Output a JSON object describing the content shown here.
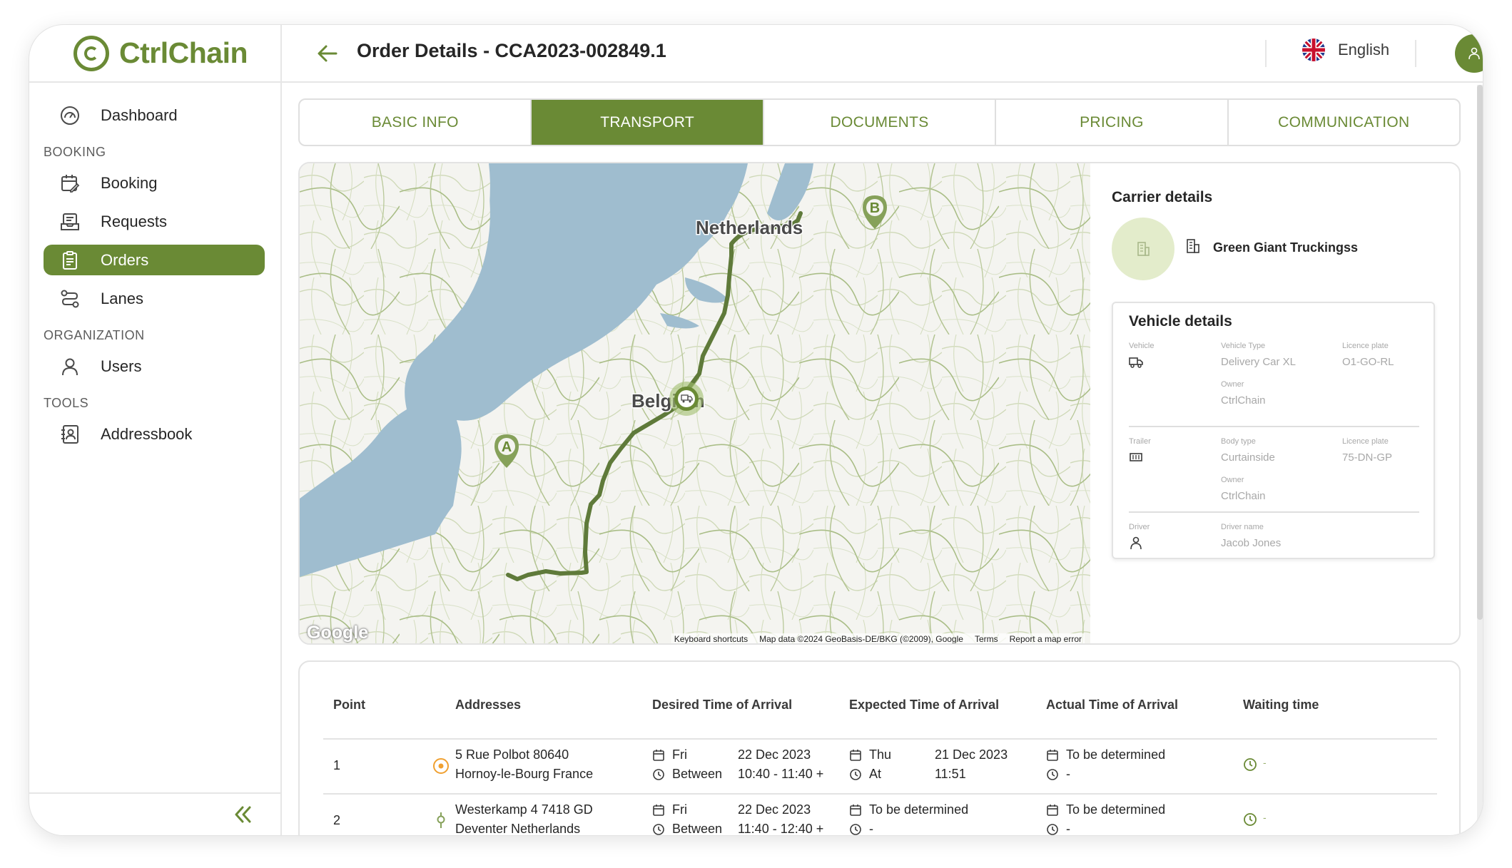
{
  "app": {
    "name": "CtrlChain"
  },
  "sidebar": {
    "items": [
      {
        "label": "Dashboard"
      },
      {
        "section": "BOOKING"
      },
      {
        "label": "Booking"
      },
      {
        "label": "Requests"
      },
      {
        "label": "Orders",
        "active": true
      },
      {
        "label": "Lanes"
      },
      {
        "section": "ORGANIZATION"
      },
      {
        "label": "Users"
      },
      {
        "section": "TOOLS"
      },
      {
        "label": "Addressbook"
      }
    ]
  },
  "header": {
    "title": "Order Details - CCA2023-002849.1",
    "language": "English"
  },
  "tabs": [
    {
      "label": "BASIC INFO"
    },
    {
      "label": "TRANSPORT",
      "active": true
    },
    {
      "label": "DOCUMENTS"
    },
    {
      "label": "PRICING"
    },
    {
      "label": "COMMUNICATION"
    }
  ],
  "map": {
    "labels": {
      "netherlands": "Netherlands",
      "belgium": "Belgium",
      "marker_a": "A",
      "marker_b": "B"
    },
    "footer": {
      "shortcuts": "Keyboard shortcuts",
      "mapdata": "Map data ©2024 GeoBasis-DE/BKG (©2009), Google",
      "terms": "Terms",
      "report": "Report a map error"
    },
    "google": "Google"
  },
  "carrier": {
    "title": "Carrier details",
    "name": "Green Giant Truckingss"
  },
  "vehicle_details": {
    "title": "Vehicle details",
    "vehicle": {
      "label": "Vehicle",
      "type_label": "Vehicle Type",
      "type": "Delivery Car XL",
      "plate_label": "Licence plate",
      "plate": "O1-GO-RL",
      "owner_label": "Owner",
      "owner": "CtrlChain"
    },
    "trailer": {
      "label": "Trailer",
      "type_label": "Body type",
      "type": "Curtainside",
      "plate_label": "Licence plate",
      "plate": "75-DN-GP",
      "owner_label": "Owner",
      "owner": "CtrlChain"
    },
    "driver": {
      "label": "Driver",
      "name_label": "Driver name",
      "name": "Jacob Jones"
    }
  },
  "points": {
    "headers": [
      "Point",
      "Addresses",
      "Desired Time of Arrival",
      "Expected Time of Arrival",
      "Actual Time of Arrival",
      "Waiting time"
    ],
    "rows": [
      {
        "point": "1",
        "address1": "5 Rue Polbot 80640",
        "address2": "Hornoy-le-Bourg France",
        "desired_day": "Fri",
        "desired_date": "22 Dec 2023",
        "desired_mode": "Between",
        "desired_time": "10:40 - 11:40 +",
        "expected_day": "Thu",
        "expected_date": "21 Dec 2023",
        "expected_mode": "At",
        "expected_time": "11:51",
        "actual": "To be determined",
        "actual_time": "-",
        "waiting": "-"
      },
      {
        "point": "2",
        "address1": "Westerkamp 4 7418 GD",
        "address2": "Deventer Netherlands",
        "desired_day": "Fri",
        "desired_date": "22 Dec 2023",
        "desired_mode": "Between",
        "desired_time": "11:40 - 12:40 +",
        "expected": "To be determined",
        "expected_time": "-",
        "actual": "To be determined",
        "actual_time": "-",
        "waiting": "-"
      }
    ]
  },
  "colors": {
    "accent": "#6a8a35",
    "accent_light": "#e3eccb",
    "route": "#5f7a3a",
    "water": "#9fbdcf",
    "land": "#f4f4f0",
    "origin": "#f0a030"
  }
}
